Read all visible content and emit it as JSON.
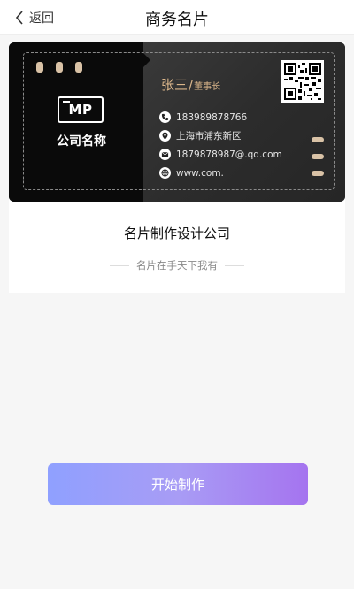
{
  "header": {
    "back_label": "返回",
    "title": "商务名片"
  },
  "card": {
    "logo_text": "MP",
    "company_name": "公司名称",
    "person_name": "张三",
    "person_title": "董事长",
    "name_separator": "/",
    "contacts": [
      {
        "icon": "phone-icon",
        "text": "183989878766"
      },
      {
        "icon": "location-icon",
        "text": "上海市浦东新区"
      },
      {
        "icon": "email-icon",
        "text": "1879878987@.qq.com"
      },
      {
        "icon": "globe-icon",
        "text": "www.com."
      }
    ],
    "accent_color": "#d9b58a"
  },
  "brand": {
    "title": "名片制作设计公司",
    "slogan": "名片在手天下我有"
  },
  "actions": {
    "start_label": "开始制作"
  }
}
